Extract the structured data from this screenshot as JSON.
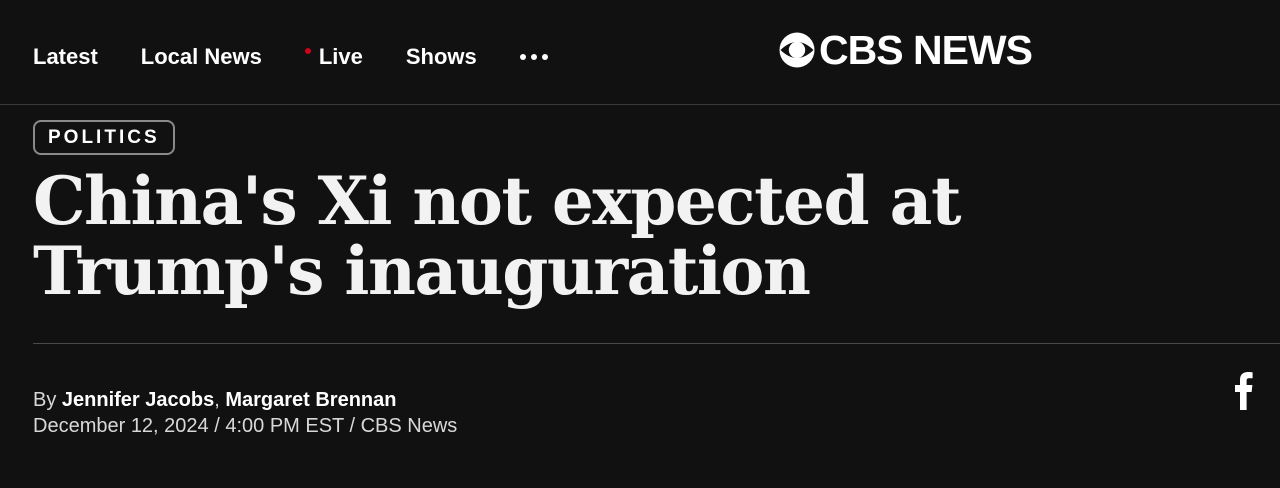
{
  "nav": {
    "items": [
      {
        "label": "Latest"
      },
      {
        "label": "Local News"
      },
      {
        "label": "Live",
        "indicator": "red-dot",
        "indicator_color": "#d0021b"
      },
      {
        "label": "Shows"
      }
    ],
    "more_icon": "ellipsis-icon"
  },
  "logo": {
    "icon": "cbs-eye-icon",
    "text": "CBS NEWS"
  },
  "article": {
    "category": "POLITICS",
    "headline": "China's Xi not expected at Trump's inauguration",
    "byline": {
      "prefix": "By",
      "authors": [
        "Jennifer Jacobs",
        "Margaret Brennan"
      ],
      "separator": ","
    },
    "dateline": "December 12, 2024 / 4:00 PM EST / CBS News"
  },
  "share": {
    "facebook_icon": "facebook-icon"
  },
  "colors": {
    "background": "#111111",
    "text": "#ffffff",
    "live_dot": "#d0021b"
  }
}
